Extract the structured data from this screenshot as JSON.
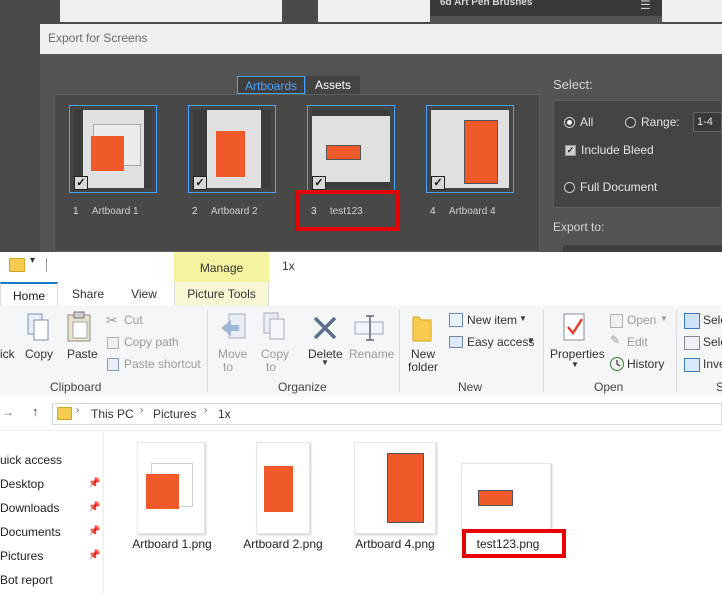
{
  "illustrator": {
    "panel_title": "6d Art Pen Brushes",
    "dialog_title": "Export for Screens",
    "tabs": [
      "Artboards",
      "Assets"
    ],
    "artboards": [
      {
        "num": "1",
        "name": "Artboard 1"
      },
      {
        "num": "2",
        "name": "Artboard 2"
      },
      {
        "num": "3",
        "name": "test123"
      },
      {
        "num": "4",
        "name": "Artboard 4"
      }
    ],
    "select_label": "Select:",
    "opt_all": "All",
    "opt_range": "Range:",
    "range_value": "1-4",
    "include_bleed": "Include Bleed",
    "opt_full_document": "Full Document",
    "export_to_label": "Export to:"
  },
  "explorer": {
    "manage_tab": "Manage",
    "folder_title": "1x",
    "tabs": {
      "home": "Home",
      "share": "Share",
      "view": "View",
      "picture_tools": "Picture Tools"
    },
    "clipboard": {
      "pin_partial": "ick",
      "copy": "Copy",
      "paste": "Paste",
      "cut": "Cut",
      "copy_path": "Copy path",
      "paste_shortcut": "Paste shortcut",
      "group": "Clipboard"
    },
    "organize": {
      "move": "Move",
      "move_to": "to",
      "copy": "Copy",
      "copy_to": "to",
      "delete": "Delete",
      "rename": "Rename",
      "group": "Organize"
    },
    "new": {
      "new_folder_1": "New",
      "new_folder_2": "folder",
      "new_item": "New item",
      "easy_access": "Easy access",
      "group": "New"
    },
    "open": {
      "properties": "Properties",
      "open": "Open",
      "edit": "Edit",
      "history": "History",
      "group": "Open"
    },
    "select": {
      "sel1": "Sele",
      "sel2": "Sele",
      "inv": "Inve",
      "group": "S"
    },
    "breadcrumb": [
      "This PC",
      "Pictures",
      "1x"
    ],
    "nav": [
      {
        "label": "uick access",
        "pinned": false
      },
      {
        "label": "Desktop",
        "pinned": true
      },
      {
        "label": "Downloads",
        "pinned": true
      },
      {
        "label": "Documents",
        "pinned": true
      },
      {
        "label": "Pictures",
        "pinned": true
      },
      {
        "label": "Bot report",
        "pinned": false
      }
    ],
    "files": [
      "Artboard 1.png",
      "Artboard 2.png",
      "Artboard 4.png",
      "test123.png"
    ]
  },
  "colors": {
    "accent": "#4aa3ff",
    "artwork": "#f05a2a",
    "highlight": "#e60000",
    "manage": "#f5f3a0"
  }
}
